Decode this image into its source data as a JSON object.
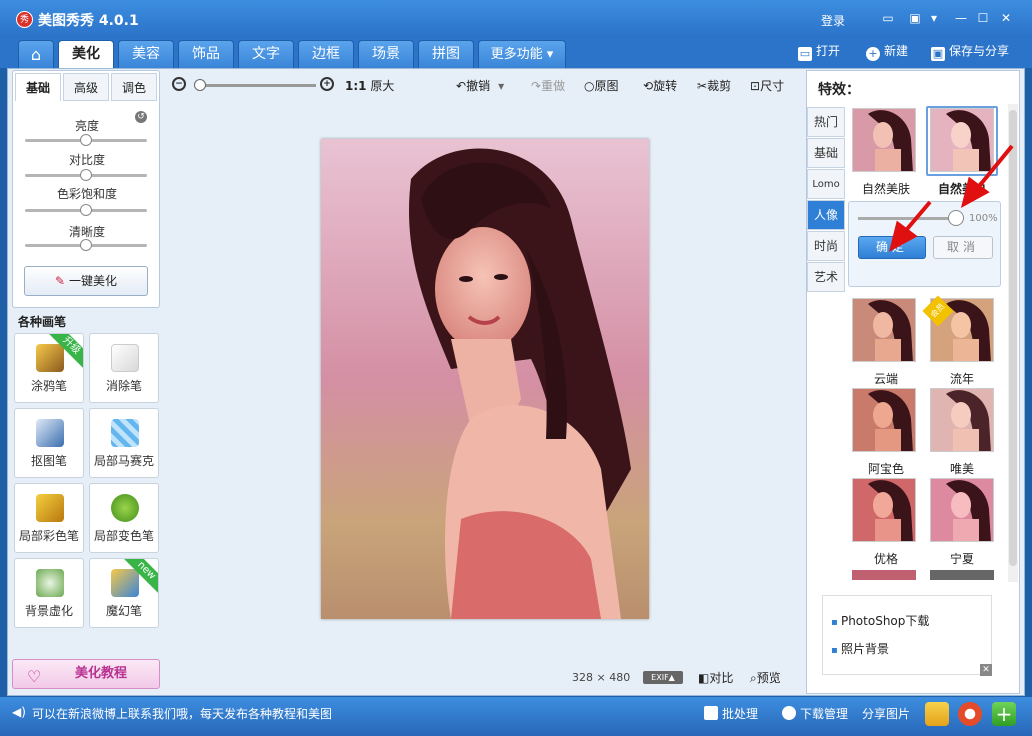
{
  "app": {
    "logo": "秀",
    "title": "美图秀秀 4.0.1",
    "login": "登录"
  },
  "window_controls": [
    {
      "name": "feedback-icon",
      "glyph": "▭"
    },
    {
      "name": "skin-icon",
      "glyph": "▣"
    },
    {
      "name": "menu-icon",
      "glyph": "▾"
    },
    {
      "name": "minimize-icon",
      "glyph": "—"
    },
    {
      "name": "maximize-icon",
      "glyph": "☐"
    },
    {
      "name": "close-icon",
      "glyph": "✕"
    }
  ],
  "nav": {
    "home_glyph": "⌂",
    "tabs": [
      "美化",
      "美容",
      "饰品",
      "文字",
      "边框",
      "场景",
      "拼图",
      "更多功能 ▾"
    ],
    "active_tab": "美化"
  },
  "top_actions": {
    "open": "打开",
    "new": "新建",
    "save": "保存与分享"
  },
  "left_panel": {
    "subtabs": [
      "基础",
      "高级",
      "调色"
    ],
    "active_subtab": "基础",
    "sliders": [
      {
        "label": "亮度",
        "value": 0.5
      },
      {
        "label": "对比度",
        "value": 0.5
      },
      {
        "label": "色彩饱和度",
        "value": 0.5
      },
      {
        "label": "清晰度",
        "value": 0.5
      }
    ],
    "one_click": "一键美化",
    "section_title": "各种画笔",
    "tools": [
      {
        "label": "涂鸦笔",
        "badge": "升级",
        "icon": "brush-icon"
      },
      {
        "label": "消除笔",
        "badge": "",
        "icon": "eraser-icon"
      },
      {
        "label": "抠图笔",
        "badge": "",
        "icon": "pen-icon"
      },
      {
        "label": "局部马赛克",
        "badge": "",
        "icon": "mosaic-icon"
      },
      {
        "label": "局部彩色笔",
        "badge": "",
        "icon": "color-brush-icon"
      },
      {
        "label": "局部变色笔",
        "badge": "",
        "icon": "paint-bucket-icon"
      },
      {
        "label": "背景虚化",
        "badge": "",
        "icon": "blur-icon"
      },
      {
        "label": "魔幻笔",
        "badge": "new",
        "icon": "magic-pen-icon"
      }
    ],
    "tutorial": "美化教程"
  },
  "toolbar": {
    "zoom_out": "−",
    "zoom_in": "+",
    "original_size": "1:1",
    "original_size_label": "原大",
    "undo": "撤销",
    "redo": "重做",
    "original": "原图",
    "rotate": "旋转",
    "crop": "裁剪",
    "resize": "尺寸"
  },
  "canvas": {
    "width_text": "328",
    "times": "×",
    "height_text": "480",
    "exif": "EXIF▲",
    "compare": "对比",
    "preview": "预览"
  },
  "effects": {
    "title": "特效：",
    "categories": [
      "热门",
      "基础",
      "Lomo",
      "人像",
      "时尚",
      "艺术"
    ],
    "active_category": "人像",
    "row1": [
      "自然美肤",
      "自然美白"
    ],
    "popup": {
      "percent": "100%",
      "confirm": "确定",
      "cancel": "取消",
      "value": 1.0
    },
    "grid": [
      {
        "label": "云端",
        "badge": ""
      },
      {
        "label": "流年",
        "badge": "会员"
      },
      {
        "label": "阿宝色",
        "badge": ""
      },
      {
        "label": "唯美",
        "badge": ""
      },
      {
        "label": "优格",
        "badge": ""
      },
      {
        "label": "宁夏",
        "badge": ""
      }
    ]
  },
  "ad": {
    "items": [
      "PhotoShop下载",
      "照片背景"
    ]
  },
  "statusbar": {
    "message": "可以在新浪微博上联系我们哦，每天发布各种教程和美图",
    "batch": "批处理",
    "download": "下载管理",
    "share": "分享图片"
  },
  "colors": {
    "accent": "#2f7fd6",
    "titlebar": "#3d8ee0",
    "arrow": "#e01010"
  }
}
